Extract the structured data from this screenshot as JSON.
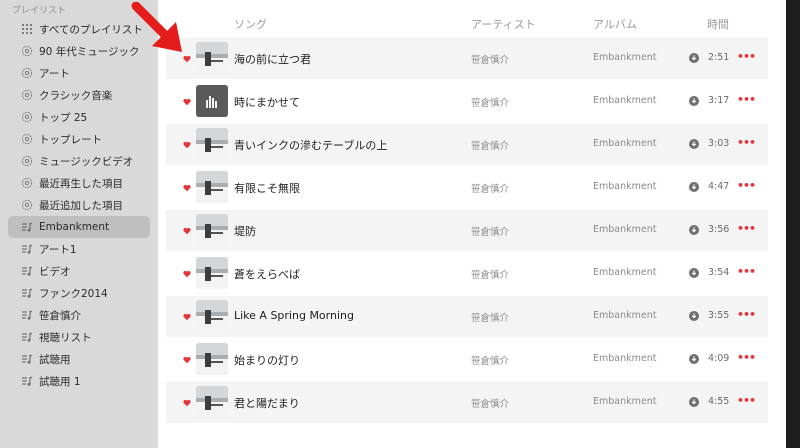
{
  "sidebar": {
    "header": "プレイリスト",
    "items": [
      {
        "label": "すべてのプレイリスト",
        "icon": "grid-icon"
      },
      {
        "label": "90 年代ミュージック",
        "icon": "gear-icon"
      },
      {
        "label": "アート",
        "icon": "gear-icon"
      },
      {
        "label": "クラシック音楽",
        "icon": "gear-icon"
      },
      {
        "label": "トップ 25",
        "icon": "gear-icon"
      },
      {
        "label": "トップレート",
        "icon": "gear-icon"
      },
      {
        "label": "ミュージックビデオ",
        "icon": "gear-icon"
      },
      {
        "label": "最近再生した項目",
        "icon": "gear-icon"
      },
      {
        "label": "最近追加した項目",
        "icon": "gear-icon"
      },
      {
        "label": "Embankment",
        "icon": "playlist-icon",
        "selected": true
      },
      {
        "label": "アート1",
        "icon": "playlist-icon"
      },
      {
        "label": "ビデオ",
        "icon": "playlist-icon"
      },
      {
        "label": "ファンク2014",
        "icon": "playlist-icon"
      },
      {
        "label": "笹倉慎介",
        "icon": "playlist-icon"
      },
      {
        "label": "視聴リスト",
        "icon": "playlist-icon"
      },
      {
        "label": "試聴用",
        "icon": "playlist-icon"
      },
      {
        "label": "試聴用 1",
        "icon": "playlist-icon"
      }
    ]
  },
  "columns": {
    "song": "ソング",
    "artist": "アーティスト",
    "album": "アルバム",
    "time": "時間"
  },
  "tracks": [
    {
      "title": "海の前に立つ君",
      "artist": "笹倉慎介",
      "album": "Embankment",
      "time": "2:51"
    },
    {
      "title": "時にまかせて",
      "artist": "笹倉慎介",
      "album": "Embankment",
      "time": "3:17"
    },
    {
      "title": "青いインクの滲むテーブルの上",
      "artist": "笹倉慎介",
      "album": "Embankment",
      "time": "3:03"
    },
    {
      "title": "有限こそ無限",
      "artist": "笹倉慎介",
      "album": "Embankment",
      "time": "4:47"
    },
    {
      "title": "堤防",
      "artist": "笹倉慎介",
      "album": "Embankment",
      "time": "3:56"
    },
    {
      "title": "蒼をえらべば",
      "artist": "笹倉慎介",
      "album": "Embankment",
      "time": "3:54"
    },
    {
      "title": "Like A Spring Morning",
      "artist": "笹倉慎介",
      "album": "Embankment",
      "time": "3:55"
    },
    {
      "title": "始まりの灯り",
      "artist": "笹倉慎介",
      "album": "Embankment",
      "time": "4:09"
    },
    {
      "title": "君と陽だまり",
      "artist": "笹倉慎介",
      "album": "Embankment",
      "time": "4:55"
    }
  ],
  "more_glyph": "•••",
  "colors": {
    "accent": "#e0353b",
    "sidebar_bg": "#d9d9d9",
    "selected_bg": "#bfbfbf",
    "arrow": "#e51c1c"
  }
}
